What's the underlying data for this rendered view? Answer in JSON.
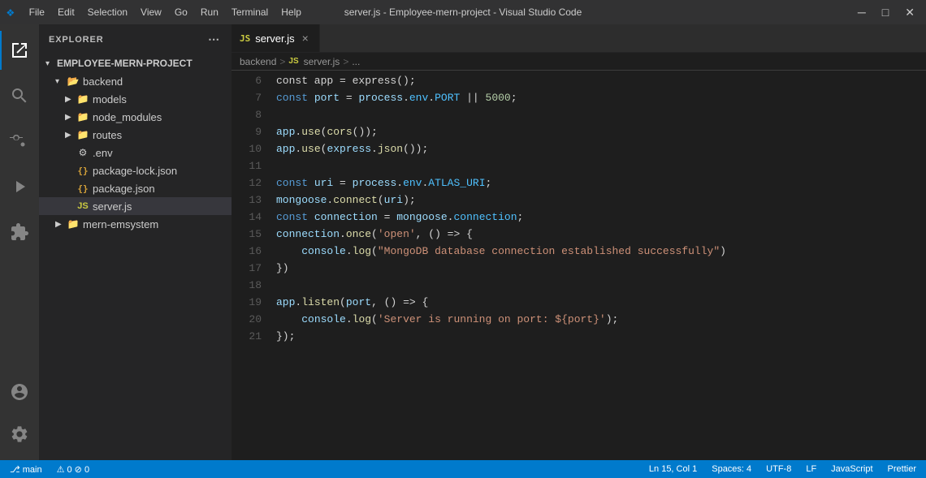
{
  "titleBar": {
    "logo": "❖",
    "menus": [
      "File",
      "Edit",
      "Selection",
      "View",
      "Go",
      "Run",
      "Terminal",
      "Help"
    ],
    "title": "server.js - Employee-mern-project - Visual Studio Code",
    "minimize": "─",
    "maximize": "□",
    "close": "✕"
  },
  "activityBar": {
    "icons": [
      {
        "name": "explorer-icon",
        "symbol": "⎘",
        "active": true
      },
      {
        "name": "search-icon",
        "symbol": "🔍",
        "active": false
      },
      {
        "name": "source-control-icon",
        "symbol": "⎇",
        "active": false
      },
      {
        "name": "run-icon",
        "symbol": "▷",
        "active": false
      },
      {
        "name": "extensions-icon",
        "symbol": "⊞",
        "active": false
      }
    ],
    "bottomIcons": [
      {
        "name": "account-icon",
        "symbol": "👤"
      },
      {
        "name": "settings-icon",
        "symbol": "⚙"
      }
    ]
  },
  "sidebar": {
    "title": "EXPLORER",
    "moreIcon": "⋯",
    "tree": {
      "projectName": "EMPLOYEE-MERN-PROJECT",
      "items": [
        {
          "label": "backend",
          "type": "folder-open",
          "indent": 1,
          "collapsed": false
        },
        {
          "label": "models",
          "type": "folder",
          "indent": 2,
          "collapsed": true
        },
        {
          "label": "node_modules",
          "type": "folder",
          "indent": 2,
          "collapsed": true
        },
        {
          "label": "routes",
          "type": "folder",
          "indent": 2,
          "collapsed": true
        },
        {
          "label": ".env",
          "type": "env",
          "indent": 2
        },
        {
          "label": "package-lock.json",
          "type": "json",
          "indent": 2
        },
        {
          "label": "package.json",
          "type": "json",
          "indent": 2
        },
        {
          "label": "server.js",
          "type": "js",
          "indent": 2,
          "selected": true
        },
        {
          "label": "mern-emsystem",
          "type": "folder",
          "indent": 1,
          "collapsed": true
        }
      ]
    }
  },
  "editor": {
    "tab": {
      "icon": "JS",
      "label": "server.js",
      "close": "×"
    },
    "breadcrumb": {
      "folder": "backend",
      "sep1": ">",
      "fileIcon": "JS",
      "file": "server.js",
      "sep2": ">",
      "ellipsis": "..."
    },
    "lines": [
      {
        "num": "6",
        "tokens": [
          {
            "t": "plain",
            "v": "const app = express();"
          }
        ]
      },
      {
        "num": "7",
        "tokens": [
          {
            "t": "kw",
            "v": "const"
          },
          {
            "t": "plain",
            "v": " "
          },
          {
            "t": "var",
            "v": "port"
          },
          {
            "t": "plain",
            "v": " = "
          },
          {
            "t": "var",
            "v": "process"
          },
          {
            "t": "plain",
            "v": "."
          },
          {
            "t": "prop",
            "v": "env"
          },
          {
            "t": "plain",
            "v": "."
          },
          {
            "t": "prop",
            "v": "PORT"
          },
          {
            "t": "plain",
            "v": " || "
          },
          {
            "t": "num",
            "v": "5000"
          },
          {
            "t": "plain",
            "v": ";"
          }
        ]
      },
      {
        "num": "8",
        "tokens": []
      },
      {
        "num": "9",
        "tokens": [
          {
            "t": "var",
            "v": "app"
          },
          {
            "t": "plain",
            "v": "."
          },
          {
            "t": "fn",
            "v": "use"
          },
          {
            "t": "plain",
            "v": "("
          },
          {
            "t": "fn",
            "v": "cors"
          },
          {
            "t": "plain",
            "v": "());"
          }
        ]
      },
      {
        "num": "10",
        "tokens": [
          {
            "t": "var",
            "v": "app"
          },
          {
            "t": "plain",
            "v": "."
          },
          {
            "t": "fn",
            "v": "use"
          },
          {
            "t": "plain",
            "v": "("
          },
          {
            "t": "var",
            "v": "express"
          },
          {
            "t": "plain",
            "v": "."
          },
          {
            "t": "fn",
            "v": "json"
          },
          {
            "t": "plain",
            "v": "());"
          }
        ]
      },
      {
        "num": "11",
        "tokens": []
      },
      {
        "num": "12",
        "tokens": [
          {
            "t": "kw",
            "v": "const"
          },
          {
            "t": "plain",
            "v": " "
          },
          {
            "t": "var",
            "v": "uri"
          },
          {
            "t": "plain",
            "v": " = "
          },
          {
            "t": "var",
            "v": "process"
          },
          {
            "t": "plain",
            "v": "."
          },
          {
            "t": "prop",
            "v": "env"
          },
          {
            "t": "plain",
            "v": "."
          },
          {
            "t": "prop",
            "v": "ATLAS_URI"
          },
          {
            "t": "plain",
            "v": ";"
          }
        ]
      },
      {
        "num": "13",
        "tokens": [
          {
            "t": "var",
            "v": "mongoose"
          },
          {
            "t": "plain",
            "v": "."
          },
          {
            "t": "fn",
            "v": "connect"
          },
          {
            "t": "plain",
            "v": "("
          },
          {
            "t": "var",
            "v": "uri"
          },
          {
            "t": "plain",
            "v": ");"
          }
        ]
      },
      {
        "num": "14",
        "tokens": [
          {
            "t": "kw",
            "v": "const"
          },
          {
            "t": "plain",
            "v": " "
          },
          {
            "t": "var",
            "v": "connection"
          },
          {
            "t": "plain",
            "v": " = "
          },
          {
            "t": "var",
            "v": "mongoose"
          },
          {
            "t": "plain",
            "v": "."
          },
          {
            "t": "prop",
            "v": "connection"
          },
          {
            "t": "plain",
            "v": ";"
          }
        ]
      },
      {
        "num": "15",
        "tokens": [
          {
            "t": "var",
            "v": "connection"
          },
          {
            "t": "plain",
            "v": "."
          },
          {
            "t": "fn",
            "v": "once"
          },
          {
            "t": "plain",
            "v": "("
          },
          {
            "t": "str",
            "v": "'open'"
          },
          {
            "t": "plain",
            "v": ", () => {"
          }
        ]
      },
      {
        "num": "16",
        "tokens": [
          {
            "t": "plain",
            "v": "    "
          },
          {
            "t": "var",
            "v": "console"
          },
          {
            "t": "plain",
            "v": "."
          },
          {
            "t": "fn",
            "v": "log"
          },
          {
            "t": "plain",
            "v": "("
          },
          {
            "t": "str",
            "v": "\"MongoDB database connection established successfully\""
          },
          {
            "t": "plain",
            "v": ")"
          }
        ]
      },
      {
        "num": "17",
        "tokens": [
          {
            "t": "plain",
            "v": "})"
          }
        ]
      },
      {
        "num": "18",
        "tokens": []
      },
      {
        "num": "19",
        "tokens": [
          {
            "t": "var",
            "v": "app"
          },
          {
            "t": "plain",
            "v": "."
          },
          {
            "t": "fn",
            "v": "listen"
          },
          {
            "t": "plain",
            "v": "("
          },
          {
            "t": "var",
            "v": "port"
          },
          {
            "t": "plain",
            "v": ", () => {"
          }
        ]
      },
      {
        "num": "20",
        "tokens": [
          {
            "t": "plain",
            "v": "    "
          },
          {
            "t": "var",
            "v": "console"
          },
          {
            "t": "plain",
            "v": "."
          },
          {
            "t": "fn",
            "v": "log"
          },
          {
            "t": "plain",
            "v": "("
          },
          {
            "t": "str",
            "v": "'Server is running on port: ${port}'"
          },
          {
            "t": "plain",
            "v": ");"
          }
        ]
      },
      {
        "num": "21",
        "tokens": [
          {
            "t": "plain",
            "v": "});"
          }
        ]
      }
    ]
  },
  "statusBar": {
    "left": [
      "⎇ main",
      "⚠ 0  ⊘ 0"
    ],
    "right": [
      "Ln 15, Col 1",
      "Spaces: 4",
      "UTF-8",
      "LF",
      "JavaScript",
      "Prettier"
    ]
  }
}
